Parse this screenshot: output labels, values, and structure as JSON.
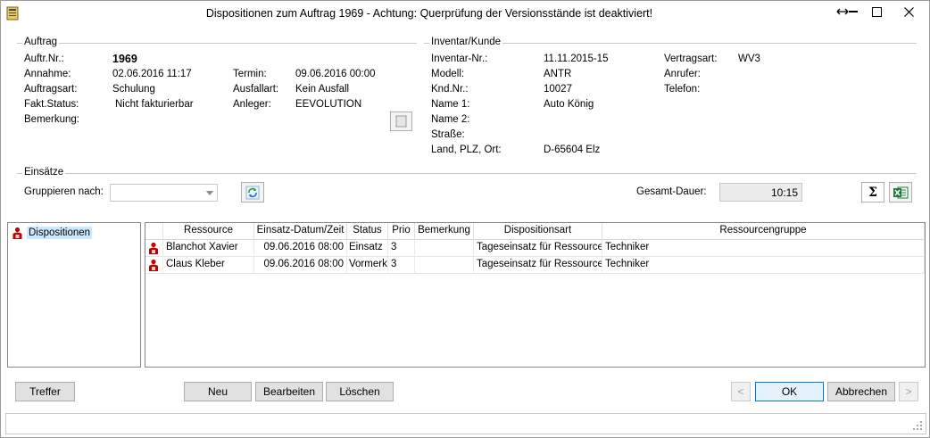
{
  "window": {
    "title": "Dispositionen zum Auftrag 1969 - Achtung: Querprüfung der Versionsstände ist deaktiviert!"
  },
  "auftrag": {
    "legend": "Auftrag",
    "auftr_nr_label": "Auftr.Nr.:",
    "auftr_nr": "1969",
    "annahme_label": "Annahme:",
    "annahme": "02.06.2016 11:17",
    "auftragsart_label": "Auftragsart:",
    "auftragsart": "Schulung",
    "fakt_status_label": "Fakt.Status:",
    "fakt_status": "Nicht fakturierbar",
    "bemerkung_label": "Bemerkung:",
    "termin_label": "Termin:",
    "termin": "09.06.2016 00:00",
    "ausfallart_label": "Ausfallart:",
    "ausfallart": "Kein Ausfall",
    "anleger_label": "Anleger:",
    "anleger": "EEVOLUTION"
  },
  "inventar": {
    "legend": "Inventar/Kunde",
    "inventar_nr_label": "Inventar-Nr.:",
    "inventar_nr": "11.11.2015-15",
    "modell_label": "Modell:",
    "modell": "ANTR",
    "knd_nr_label": "Knd.Nr.:",
    "knd_nr": "10027",
    "name1_label": "Name 1:",
    "name1": "Auto König",
    "name2_label": "Name 2:",
    "strasse_label": "Straße:",
    "ort_label": "Land, PLZ, Ort:",
    "ort": "D-65604 Elz",
    "vertragsart_label": "Vertragsart:",
    "vertragsart": "WV3",
    "anrufer_label": "Anrufer:",
    "telefon_label": "Telefon:"
  },
  "einsaetze": {
    "legend": "Einsätze",
    "gruppieren_label": "Gruppieren nach:",
    "gruppieren_value": "",
    "gesamt_dauer_label": "Gesamt-Dauer:",
    "gesamt_dauer": "10:15"
  },
  "tree": {
    "root_label": "Dispositionen"
  },
  "grid": {
    "headers": [
      "Ressource",
      "Einsatz-Datum/Zeit",
      "Status",
      "Prio",
      "Bemerkung",
      "Dispositionsart",
      "Ressourcengruppe"
    ],
    "rows": [
      {
        "ressource": "Blanchot Xavier",
        "datum": "09.06.2016 08:00",
        "status": "Einsatz",
        "prio": "3",
        "bemerkung": "",
        "art": "Tageseinsatz für Ressource",
        "gruppe": "Techniker"
      },
      {
        "ressource": "Claus Kleber",
        "datum": "09.06.2016 08:00",
        "status": "Vormerkung",
        "prio": "3",
        "bemerkung": "",
        "art": "Tageseinsatz für Ressource",
        "gruppe": "Techniker"
      }
    ]
  },
  "buttons": {
    "treffer": "Treffer",
    "neu": "Neu",
    "bearbeiten": "Bearbeiten",
    "loeschen": "Löschen",
    "prev": "<",
    "ok": "OK",
    "abbrechen": "Abbrechen",
    "next": ">"
  },
  "icons": {
    "sigma": "Σ"
  },
  "colors": {
    "default_button_border": "#0078d7",
    "selection": "#cce8ff",
    "excel_green": "#1d7a3a",
    "resource_red": "#c00000"
  }
}
